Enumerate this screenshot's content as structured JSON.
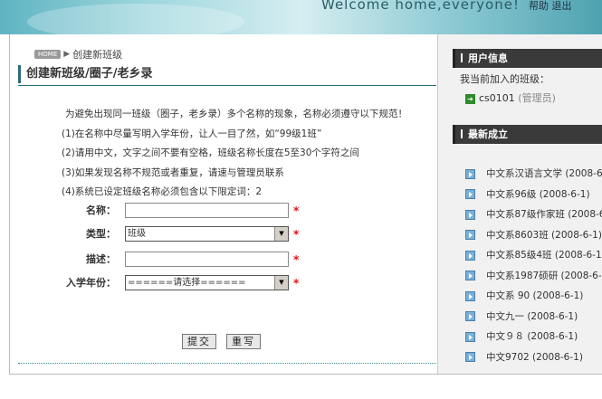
{
  "banner": {
    "welcome": "Welcome home,everyone!",
    "links": "帮助 退出"
  },
  "breadcrumb": {
    "home": "HOME",
    "arrow": "▶",
    "current": "创建新班级"
  },
  "page_title": "创建新班级/圈子/老乡录",
  "rules": {
    "head": "为避免出现同一班级（圈子，老乡录）多个名称的现象，名称必须遵守以下规范！",
    "items": [
      "(1)在名称中尽量写明入学年份，让人一目了然，如“99级1班”",
      "(2)请用中文，文字之间不要有空格，班级名称长度在5至30个字符之间",
      "(3)如果发现名称不规范或者重复，请速与管理员联系",
      "(4)系统已设定班级名称必须包含以下限定词：2"
    ]
  },
  "form": {
    "name_label": "名称：",
    "name_value": "",
    "type_label": "类型：",
    "type_value": "班级",
    "desc_label": "描述：",
    "desc_value": "",
    "year_label": "入学年份：",
    "year_value": "======请选择======",
    "required_mark": "*",
    "submit": "提交",
    "reset": "重写"
  },
  "sidebar": {
    "user_info_title": "用户信息",
    "my_classes_label": "我当前加入的班级：",
    "my_class": {
      "name": "cs0101",
      "role": "(管理员)"
    },
    "new_title": "最新成立",
    "new_items": [
      "中文系汉语言文学 (2008-6",
      "中文系96级 (2008-6-1)",
      "中文系87级作家班 (2008-6",
      "中文系8603班 (2008-6-1)",
      "中文系85级4班 (2008-6-1",
      "中文系1987硕研 (2008-6-",
      "中文系 90 (2008-6-1)",
      "中文九一 (2008-6-1)",
      "中文９８ (2008-6-1)",
      "中文9702 (2008-6-1)"
    ]
  },
  "icons": {
    "arrow_right": "arrow-right-icon",
    "bullet": "bullet-arrow-icon",
    "dropdown": "chevron-down-icon"
  }
}
